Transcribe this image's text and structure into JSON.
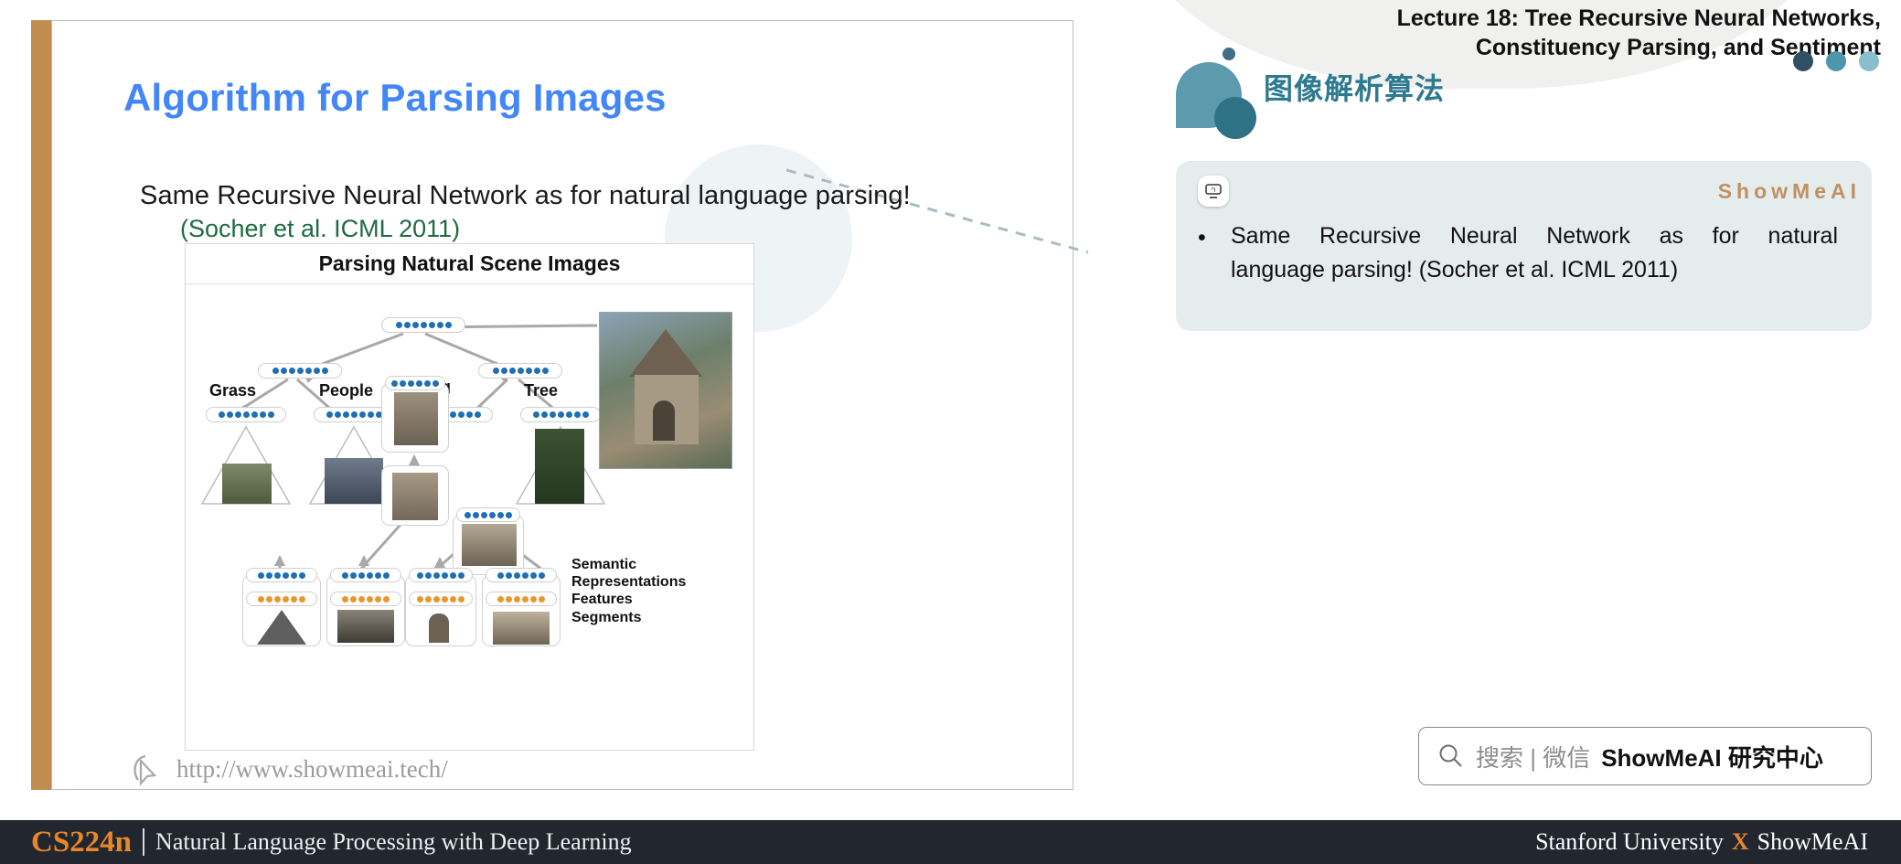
{
  "header": {
    "lecture_title_line1": "Lecture 18: Tree Recursive Neural Networks,",
    "lecture_title_line2": "Constituency Parsing, and Sentiment",
    "chinese_title": "图像解析算法",
    "dots": [
      "#2f4f63",
      "#4e96ab",
      "#88bece"
    ],
    "accent_teal": "#2d7a90"
  },
  "card": {
    "brand": "ShowMeAI",
    "bullet_marker": "•",
    "bullet_line1": "Same  Recursive  Neural  Network  as  for  natural",
    "bullet_line2": "language parsing! (Socher et al. ICML 2011)",
    "bg_color": "#e5ecee",
    "brand_color": "#c09060"
  },
  "slide": {
    "title": "Algorithm for Parsing Images",
    "title_color": "#4287f5",
    "body_line": "Same Recursive Neural Network as for natural language parsing!",
    "citation": "(Socher et al. ICML 2011)",
    "citation_color": "#1d6b40",
    "spine_color": "#c08c50",
    "watermark_url": "http://www.showmeai.tech/"
  },
  "figure": {
    "caption": "Parsing Natural Scene Images",
    "tree_labels": [
      "Grass",
      "People",
      "Building",
      "Tree"
    ],
    "right_labels": [
      "Semantic",
      "Representations",
      "Features",
      "Segments"
    ],
    "dot_blue": "#1f6fb4",
    "dot_orange": "#e8962e"
  },
  "search": {
    "grey_text": "搜索 | 微信",
    "bold_text": "ShowMeAI 研究中心"
  },
  "footer": {
    "course_code": "CS224n",
    "course_name": "Natural Language Processing with Deep Learning",
    "org_left": "Stanford University",
    "org_x": "X",
    "org_right": "ShowMeAI",
    "bg_color": "#22262f",
    "accent_color": "#e8862a"
  }
}
